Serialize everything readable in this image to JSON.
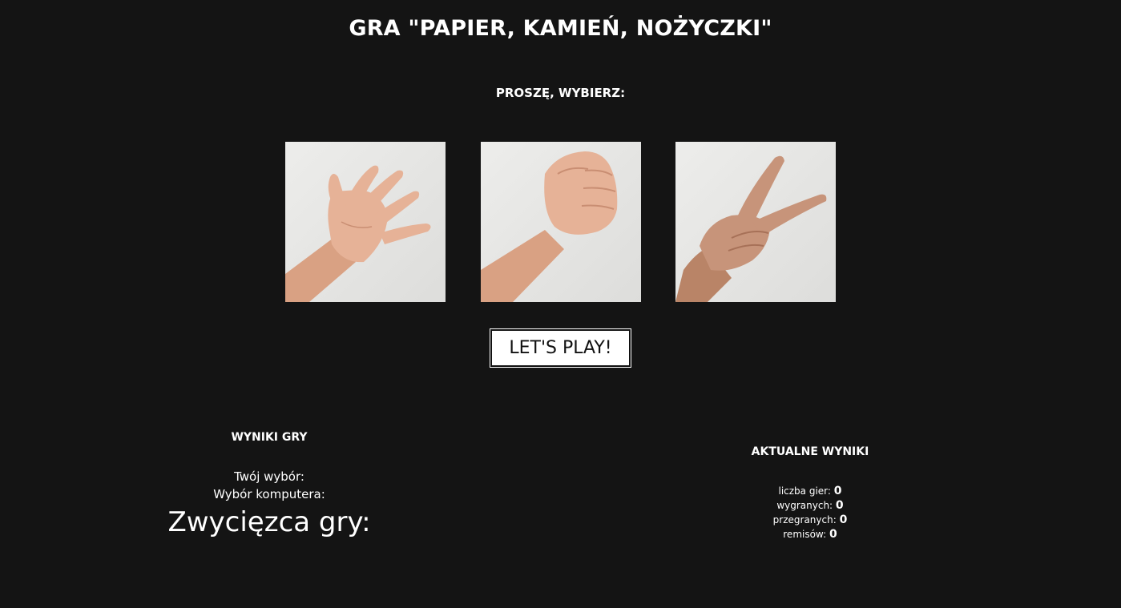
{
  "header": {
    "title": "GRA \"PAPIER, KAMIEŃ, NOŻYCZKI\"",
    "prompt": "PROSZĘ, WYBIERZ:"
  },
  "choices": [
    {
      "id": "paper",
      "icon": "open-hand-paper-icon"
    },
    {
      "id": "rock",
      "icon": "fist-rock-icon"
    },
    {
      "id": "scissors",
      "icon": "v-sign-scissors-icon"
    }
  ],
  "play_button": {
    "label": "LET'S PLAY!"
  },
  "results": {
    "heading": "WYNIKI GRY",
    "your_choice_label": "Twój wybór:",
    "computer_choice_label": "Wybór komputera:",
    "winner_label": "Zwycięzca gry:"
  },
  "scores": {
    "heading": "AKTUALNE WYNIKI",
    "games_label": "liczba gier:",
    "games_value": "0",
    "wins_label": "wygranych:",
    "wins_value": "0",
    "losses_label": "przegranych:",
    "losses_value": "0",
    "draws_label": "remisów:",
    "draws_value": "0"
  },
  "colors": {
    "background": "#141414",
    "text": "#ffffff",
    "button_bg": "#ffffff",
    "button_text": "#111111",
    "photo_bg": "#e6e6e4",
    "skin": "#e2ab90"
  }
}
